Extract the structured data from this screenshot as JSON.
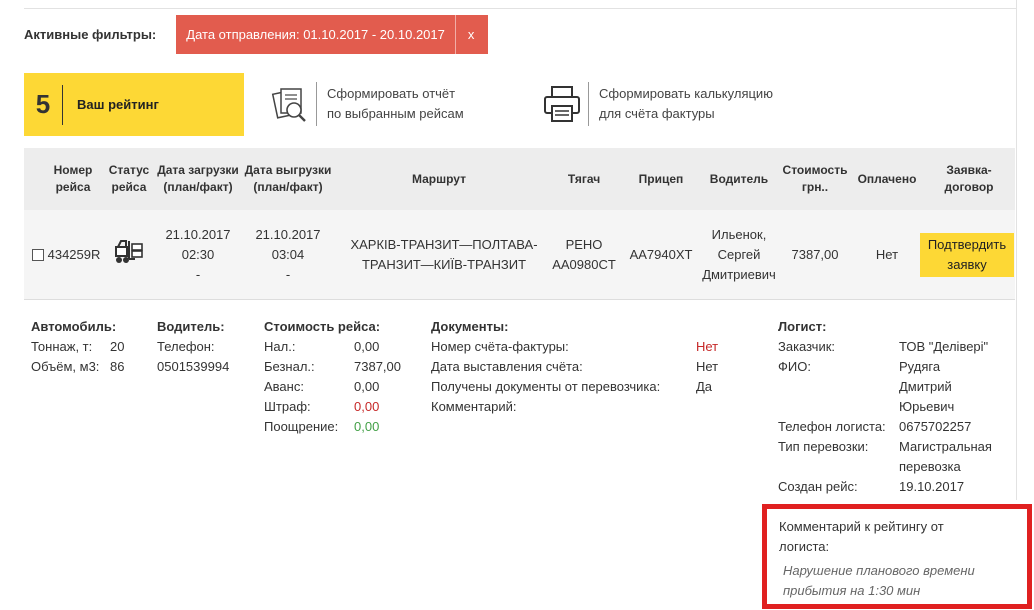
{
  "filters": {
    "label": "Активные фильтры:",
    "chip_text": "Дата отправления: 01.10.2017 - 20.10.2017",
    "chip_close": "x"
  },
  "rating": {
    "number": "5",
    "label": "Ваш рейтинг"
  },
  "actions": {
    "report_line1": "Сформировать отчёт",
    "report_line2": "по выбранным рейсам",
    "calc_line1": "Сформировать калькуляцию",
    "calc_line2": "для счёта фактуры"
  },
  "table": {
    "headers": {
      "trip_no": [
        "Номер",
        "рейса"
      ],
      "status": [
        "Статус",
        "рейса"
      ],
      "load_date": [
        "Дата загрузки",
        "(план/факт)"
      ],
      "unload_date": [
        "Дата выгрузки",
        "(план/факт)"
      ],
      "route": "Маршрут",
      "tractor": "Тягач",
      "trailer": "Прицеп",
      "driver": "Водитель",
      "cost": [
        "Стоимость",
        "грн.."
      ],
      "paid": "Оплачено",
      "request": [
        "Заявка-",
        "договор"
      ]
    },
    "row": {
      "trip_no": "434259R",
      "load": [
        "21.10.2017",
        "02:30",
        "-"
      ],
      "unload": [
        "21.10.2017",
        "03:04",
        "-"
      ],
      "route": [
        "ХАРКІВ-ТРАНЗИТ—ПОЛТАВА-",
        "ТРАНЗИТ—КИЇВ-ТРАНЗИТ"
      ],
      "tractor": [
        "РЕНО",
        "AA0980CT"
      ],
      "trailer": "AA7940XT",
      "driver": [
        "Ильенок,",
        "Сергей",
        "Дмитриевич"
      ],
      "cost": "7387,00",
      "paid": "Нет",
      "confirm": [
        "Подтвердить",
        "заявку"
      ]
    }
  },
  "details": {
    "vehicle": {
      "title": "Автомобиль:",
      "tonnage_label": "Тоннаж, т:",
      "tonnage": "20",
      "volume_label": "Объём, м3:",
      "volume": "86"
    },
    "driver": {
      "title": "Водитель:",
      "phone_label": "Телефон:",
      "phone": "0501539994"
    },
    "cost": {
      "title": "Стоимость рейса:",
      "cash_label": "Нал.:",
      "cash": "0,00",
      "noncash_label": "Безнал.:",
      "noncash": "7387,00",
      "advance_label": "Аванс:",
      "advance": "0,00",
      "fine_label": "Штраф:",
      "fine": "0,00",
      "bonus_label": "Поощрение:",
      "bonus": "0,00"
    },
    "docs": {
      "title": "Документы:",
      "invoice_no_label": "Номер счёта-фактуры:",
      "invoice_no": "Нет",
      "invoice_date_label": "Дата выставления счёта:",
      "invoice_date": "Нет",
      "received_label": "Получены документы от перевозчика:",
      "received": "Да",
      "comment_label": "Комментарий:"
    },
    "logist": {
      "title": "Логист:",
      "customer_label": "Заказчик:",
      "customer": "ТОВ \"Делівері\"",
      "fio_label": "ФИО:",
      "fio": [
        "Рудяга",
        "Дмитрий",
        "Юрьевич"
      ],
      "phone_label": "Телефон логиста:",
      "phone": "0675702257",
      "type_label": "Тип перевозки:",
      "type": [
        "Магистральная",
        "перевозка"
      ],
      "created_label": "Создан рейс:",
      "created": "19.10.2017"
    }
  },
  "rating_comment": {
    "label": [
      "Комментарий к рейтингу от",
      "логиста:"
    ],
    "value": [
      "Нарушение планового времени",
      "прибытия на 1:30 мин"
    ]
  },
  "colors": {
    "accent_yellow": "#fdd835",
    "chip_red": "#e25c4e",
    "highlight_red": "#e02020"
  }
}
